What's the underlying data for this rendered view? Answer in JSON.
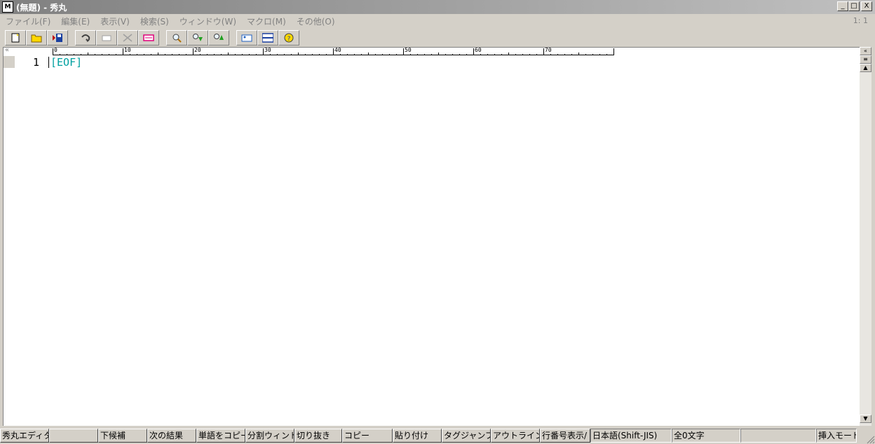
{
  "window": {
    "title": "(無題) - 秀丸",
    "icon_label": "M",
    "minimize": "_",
    "maximize": "□",
    "close": "X"
  },
  "menu": {
    "items": [
      {
        "label": "ファイル(F)"
      },
      {
        "label": "編集(E)"
      },
      {
        "label": "表示(V)"
      },
      {
        "label": "検索(S)"
      },
      {
        "label": "ウィンドウ(W)"
      },
      {
        "label": "マクロ(M)"
      },
      {
        "label": "その他(O)"
      }
    ],
    "cursor_pos": "1: 1"
  },
  "toolbar": {
    "buttons": [
      {
        "icon": "new-file-icon"
      },
      {
        "icon": "open-folder-icon"
      },
      {
        "icon": "save-icon"
      },
      {
        "icon": "undo-icon"
      },
      {
        "icon": "copy-icon"
      },
      {
        "icon": "cut-icon"
      },
      {
        "icon": "paste-icon"
      },
      {
        "icon": "find-icon"
      },
      {
        "icon": "find-next-icon"
      },
      {
        "icon": "find-prev-icon"
      },
      {
        "icon": "tag-jump-icon"
      },
      {
        "icon": "split-window-icon"
      },
      {
        "icon": "help-icon"
      }
    ]
  },
  "ruler": {
    "left_mark": "«",
    "labels": [
      "0",
      "10",
      "20",
      "30",
      "40",
      "50",
      "60",
      "70"
    ]
  },
  "editor": {
    "line_number": "1",
    "eof_marker": "[EOF]"
  },
  "scrollbar": {
    "top_btn": "«",
    "mid_btn": "≡",
    "up_btn": "▲",
    "down_btn": "▼"
  },
  "statusbar": {
    "func_keys": [
      "秀丸エディタヘル",
      "",
      "下候補",
      "次の結果",
      "単語をコピー",
      "分割ウィンドウ切",
      "切り抜き",
      "コピー",
      "貼り付け",
      "タグジャンプ",
      "アウトライン解析",
      "行番号表示/"
    ],
    "encoding": "日本語(Shift-JIS)",
    "char_count": "全0文字",
    "empty": "",
    "mode": "挿入モード"
  },
  "colors": {
    "eof": "#00a0a0",
    "face": "#d4d0c8"
  }
}
